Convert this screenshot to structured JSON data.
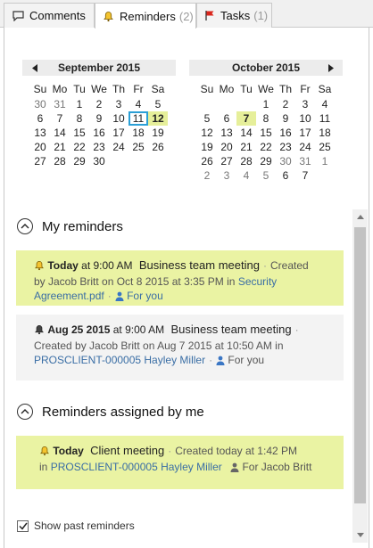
{
  "tabs": [
    {
      "label": "Comments",
      "count": "",
      "icon": "comment-icon"
    },
    {
      "label": "Reminders",
      "count": "(2)",
      "icon": "bell-icon"
    },
    {
      "label": "Tasks",
      "count": "(1)",
      "icon": "flag-icon"
    }
  ],
  "calendars": {
    "weekdays": [
      "Su",
      "Mo",
      "Tu",
      "We",
      "Th",
      "Fr",
      "Sa"
    ],
    "left": {
      "title": "September 2015",
      "days": [
        "30",
        "31",
        "1",
        "2",
        "3",
        "4",
        "5",
        "6",
        "7",
        "8",
        "9",
        "10",
        "11",
        "12",
        "13",
        "14",
        "15",
        "16",
        "17",
        "18",
        "19",
        "20",
        "21",
        "22",
        "23",
        "24",
        "25",
        "26",
        "27",
        "28",
        "29",
        "30"
      ],
      "muted": [
        0,
        1
      ],
      "marked": [
        13
      ],
      "today": [
        11
      ],
      "boxed": [
        12
      ]
    },
    "right": {
      "title": "October 2015",
      "days": [
        "",
        "",
        "",
        "1",
        "2",
        "3",
        "4",
        "5",
        "6",
        "7",
        "8",
        "9",
        "10",
        "11",
        "12",
        "13",
        "14",
        "15",
        "16",
        "17",
        "18",
        "19",
        "20",
        "21",
        "22",
        "23",
        "24",
        "25",
        "26",
        "27",
        "28",
        "29",
        "30",
        "31",
        "1",
        "2",
        "3",
        "4",
        "5",
        "6",
        "7"
      ],
      "muted": [
        32,
        33,
        34,
        35,
        36,
        37,
        38
      ],
      "marked": [
        9
      ]
    }
  },
  "my_reminders": {
    "title": "My reminders",
    "items": [
      {
        "when": "Today",
        "time": "at 9:00 AM",
        "subject": "Business team meeting",
        "created_prefix": "Created",
        "created_by": "by Jacob Britt on Oct 8 2015 at 3:35 PM in",
        "link": "Security Agreement.pdf",
        "for": "For you"
      },
      {
        "when": "Aug 25 2015",
        "time": "at 9:00 AM",
        "subject": "Business team meeting",
        "created_by": "Created by Jacob Britt on Aug 7 2015 at 10:50 AM in",
        "link": "PROSCLIENT-000005 Hayley Miller",
        "for": "For you"
      }
    ]
  },
  "assigned": {
    "title": "Reminders assigned by me",
    "items": [
      {
        "when": "Today",
        "subject": "Client meeting",
        "created": "Created today at 1:42 PM",
        "in": "in",
        "link": "PROSCLIENT-000005 Hayley Miller",
        "for": "For Jacob Britt"
      }
    ]
  },
  "footer": {
    "show_past_label": "Show past reminders",
    "checked": true
  }
}
